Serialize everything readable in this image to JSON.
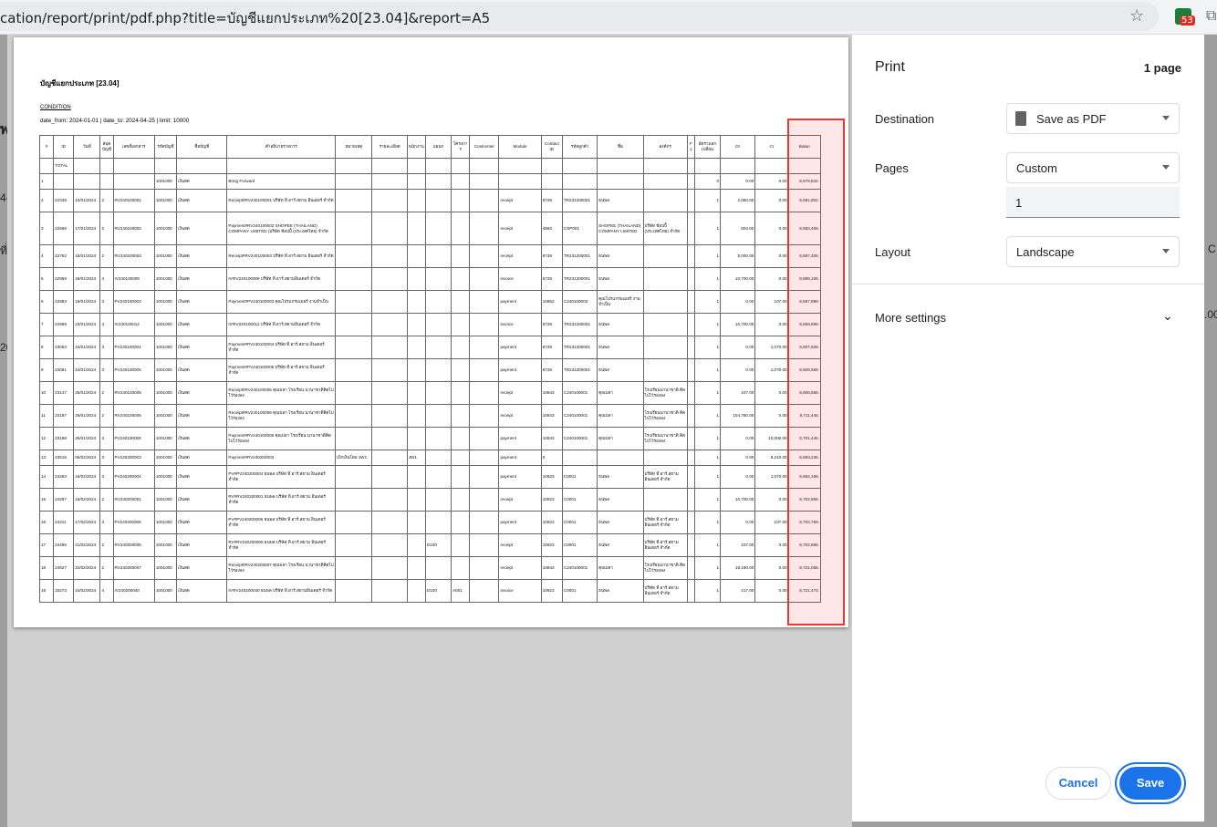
{
  "browser": {
    "url": "cation/report/print/pdf.php?title=บัญชีแยกประเภท%20[23.04]&report=A5",
    "extension_badge": "53"
  },
  "background_page": {
    "fragments": [
      {
        "text": "พ"
      },
      {
        "text": "4-"
      },
      {
        "text": "ที่"
      },
      {
        "text": "C"
      },
      {
        "text": "20"
      },
      {
        "text": ".00"
      }
    ]
  },
  "report": {
    "title": "บัญชีแยกประเภท [23.04]",
    "condition_label": "CONDITION",
    "condition_line": "date_from: 2024-01-01 | date_to: 2024-04-25 | limit: 10000",
    "headers": [
      "#",
      "ID",
      "วันที่",
      "สมุดบัญชี",
      "เลขที่เอกสาร",
      "รหัสบัญชี",
      "ชื่อบัญชี",
      "คำอธิบายรายการ",
      "หมายเหตุ",
      "รายละเอียด",
      "พนักงาน",
      "แผนก",
      "โครงการ",
      "Costcenter",
      "Module",
      "Contact ID",
      "รหัสลูกค้า",
      "ชื่อ",
      "องค์กร",
      "Fx",
      "อัตราแลกเปลี่ยน",
      "Dr",
      "Cr",
      "Balan"
    ],
    "total_label": "TOTAL",
    "rows": [
      [
        "1",
        "",
        "",
        "",
        "",
        "1001000",
        "เงินสด",
        "Bring Forward",
        "",
        "",
        "",
        "",
        "",
        "",
        "",
        "",
        "",
        "",
        "",
        "",
        "0",
        "0.00",
        "0.00",
        "8,579,842."
      ],
      [
        "2",
        "22338",
        "10/01/2024",
        "2",
        "RV240100001",
        "1001000",
        "เงินสด",
        "Receipt#RV240100001 บริษัท ที.อาร์.สยาม อินเตอร์ จำกัด",
        "",
        "",
        "",
        "",
        "",
        "",
        "receipt",
        "6729",
        "TR231200001",
        "ธนพล",
        "",
        "",
        "1",
        "2,060.00",
        "0.00",
        "8,581,902."
      ],
      [
        "3",
        "22669",
        "17/01/2024",
        "2",
        "RV240100002",
        "1001000",
        "เงินสด",
        "Payment#RV240100002 SHOPEE (THAILAND) COMPANY LIMITED (บริษัท ช้อปปี้ (ประเทศไทย) จำกัด",
        "",
        "",
        "",
        "",
        "",
        "",
        "receipt",
        "4963",
        "CSP001",
        "SHOPEE (THAILAND) COMPANY LIMITED",
        "บริษัท ช้อปปี้ (ประเทศไทย) จำกัด",
        "",
        "1",
        "504.00",
        "0.00",
        "8,582,406."
      ],
      [
        "4",
        "22762",
        "18/01/2024",
        "2",
        "RV240100003",
        "1001000",
        "เงินสด",
        "Receipt#RV240100003 บริษัท ที.อาร์.สยาม อินเตอร์ จำกัด",
        "",
        "",
        "",
        "",
        "",
        "",
        "receipt",
        "6729",
        "TR231200001",
        "ธนพล",
        "",
        "",
        "1",
        "5,000.00",
        "0.00",
        "8,587,406."
      ],
      [
        "5",
        "22959",
        "18/01/2024",
        "4",
        "IV240100009",
        "1001000",
        "เงินสด",
        "IV#IV240100009 บริษัท ที.อาร์.สยามอินเตอร์ จำกัด",
        "",
        "",
        "",
        "",
        "",
        "",
        "invoice",
        "6729",
        "TR231200001",
        "ธนพล",
        "",
        "",
        "1",
        "10,700.00",
        "0.00",
        "8,598,106."
      ],
      [
        "6",
        "22883",
        "19/01/2024",
        "3",
        "PV240100003",
        "1001000",
        "เงินสด",
        "Payment#PV240100003 คุณโปรแกรมเมอร์ งานจำเป็น",
        "",
        "",
        "",
        "",
        "",
        "",
        "payment",
        "10852",
        "C240100003",
        "คุณโปรแกรมเมอร์ งานจำเป็น",
        "",
        "",
        "1",
        "0.00",
        "107.00",
        "8,597,999."
      ],
      [
        "7",
        "22999",
        "23/01/2024",
        "4",
        "IV240100012",
        "1001000",
        "เงินสด",
        "IV#IV240100012 บริษัท ที.อาร์.สยามอินเตอร์ จำกัด",
        "",
        "",
        "",
        "",
        "",
        "",
        "invoice",
        "6729",
        "TR231200001",
        "ธนพล",
        "",
        "",
        "1",
        "10,700.00",
        "0.00",
        "8,608,699."
      ],
      [
        "8",
        "23053",
        "24/01/2024",
        "3",
        "PV240100004",
        "1001000",
        "เงินสด",
        "Payment#PV240100004 บริษัท ที.อาร์.สยาม อินเตอร์ จำกัด",
        "",
        "",
        "",
        "",
        "",
        "",
        "payment",
        "6729",
        "TR231200001",
        "ธนพล",
        "",
        "",
        "1",
        "0.00",
        "1,070.00",
        "8,607,629."
      ],
      [
        "9",
        "23061",
        "24/01/2024",
        "3",
        "PV240100005",
        "1001000",
        "เงินสด",
        "Payment#PV240100005 บริษัท ที.อาร์.สยาม อินเตอร์ จำกัด",
        "",
        "",
        "",
        "",
        "",
        "",
        "payment",
        "6729",
        "TR231200001",
        "ธนพล",
        "",
        "",
        "1",
        "0.00",
        "1,070.00",
        "8,606,559."
      ],
      [
        "10",
        "23147",
        "25/01/2024",
        "2",
        "RV240100005",
        "1001000",
        "เงินสด",
        "Receipt#RV240100005 คุณปลา โรงเรียน นานาชาติคิดไปไว้รองลง",
        "",
        "",
        "",
        "",
        "",
        "",
        "receipt",
        "10843",
        "C240100001",
        "คุณปลา",
        "โรงเรียนนานาชาติ คิดไปไว้รองลง",
        "",
        "1",
        "107.00",
        "0.00",
        "8,606,666."
      ],
      [
        "11",
        "23187",
        "26/01/2024",
        "2",
        "RV240100006",
        "1001000",
        "เงินสด",
        "Receipt#RV240100006 คุณปลา โรงเรียน นานาชาติคิดไปไว้รองลง",
        "",
        "",
        "",
        "",
        "",
        "",
        "receipt",
        "10843",
        "C240100001",
        "คุณปลา",
        "โรงเรียนนานาชาติ คิดไปไว้รองลง",
        "",
        "1",
        "104,780.00",
        "0.00",
        "8,711,446."
      ],
      [
        "12",
        "23188",
        "26/01/2024",
        "3",
        "PV240100006",
        "1001000",
        "เงินสด",
        "Payment#PV240100006 คุณปลา โรงเรียน นานาชาติคิดไปไว้รองลง",
        "",
        "",
        "",
        "",
        "",
        "",
        "payment",
        "10843",
        "C240100001",
        "คุณปลา",
        "โรงเรียนนานาชาติ คิดไปไว้รองลง",
        "",
        "1",
        "0.00",
        "10,000.00",
        "8,701,446."
      ],
      [
        "13",
        "23515",
        "05/02/2024",
        "3",
        "PV240200003",
        "1001000",
        "เงินสด",
        "Payment#PV240200003",
        "เบิกเงินโดย JW1",
        "",
        "JW1",
        "",
        "",
        "",
        "payment",
        "0",
        "",
        "",
        "",
        "",
        "1",
        "0.00",
        "8,210.00",
        "8,693,236."
      ],
      [
        "14",
        "24263",
        "16/02/2024",
        "3",
        "PV240200004",
        "1001000",
        "เงินสด",
        "PV#PV240200004 ธนพล บริษัท ที.อาร์.สยาม อินเตอร์ จำกัด",
        "",
        "",
        "",
        "",
        "",
        "",
        "payment",
        "10923",
        "C0001",
        "ธนพล",
        "บริษัท ที.อาร์.สยาม อินเตอร์ จำกัด",
        "",
        "1",
        "0.00",
        "1,070.00",
        "8,692,166."
      ],
      [
        "15",
        "24287",
        "16/02/2024",
        "2",
        "RV240200001",
        "1001000",
        "เงินสด",
        "RV#RV240200001 ธนพล บริษัท ที.อาร์.สยาม อินเตอร์ จำกัด",
        "",
        "",
        "",
        "",
        "",
        "",
        "receipt",
        "10923",
        "C0001",
        "ธนพล",
        "",
        "",
        "1",
        "10,700.00",
        "0.00",
        "8,702,866."
      ],
      [
        "16",
        "24311",
        "17/02/2024",
        "3",
        "PV240200006",
        "1001000",
        "เงินสด",
        "PV#PV240200006 ธนพล บริษัท ที.อาร์.สยาม อินเตอร์ จำกัด",
        "",
        "",
        "",
        "",
        "",
        "",
        "payment",
        "10923",
        "C0001",
        "ธนพล",
        "บริษัท ที.อาร์.สยาม อินเตอร์ จำกัด",
        "",
        "1",
        "0.00",
        "107.00",
        "8,702,759."
      ],
      [
        "17",
        "24495",
        "21/02/2024",
        "2",
        "RV240200005",
        "1001000",
        "เงินสด",
        "RV#RV240200005 ธนพล บริษัท ที.อาร์.สยาม อินเตอร์ จำกัด",
        "",
        "",
        "",
        "D100",
        "",
        "",
        "receipt",
        "10923",
        "C0001",
        "ธนพล",
        "บริษัท ที.อาร์.สยาม อินเตอร์ จำกัด",
        "",
        "1",
        "107.00",
        "0.00",
        "8,702,866."
      ],
      [
        "18",
        "24627",
        "22/02/2024",
        "2",
        "RV240200007",
        "1001000",
        "เงินสด",
        "Receipt#RV240200007 คุณปลา โรงเรียน นานาชาติคิดไปไว้รองลง",
        "",
        "",
        "",
        "",
        "",
        "",
        "receipt",
        "10843",
        "C240100001",
        "คุณปลา",
        "โรงเรียนนานาชาติ คิดไปไว้รองลง",
        "",
        "1",
        "18,190.00",
        "0.00",
        "8,721,056."
      ],
      [
        "19",
        "33273",
        "24/02/2024",
        "4",
        "IV240200040",
        "1001000",
        "เงินสด",
        "IV#IV240200040 ธนพล บริษัท ที.อาร์.สยามอินเตอร์ จำกัด",
        "",
        "",
        "",
        "D100",
        "A001",
        "",
        "invoice",
        "10923",
        "C0001",
        "ธนพล",
        "บริษัท ที.อาร์.สยาม อินเตอร์ จำกัด",
        "",
        "1",
        "417.00",
        "0.00",
        "8,721,473."
      ]
    ]
  },
  "print_dialog": {
    "title": "Print",
    "page_count": "1 page",
    "destination_label": "Destination",
    "destination_value": "Save as PDF",
    "pages_label": "Pages",
    "pages_value": "Custom",
    "pages_custom_value": "1",
    "layout_label": "Layout",
    "layout_value": "Landscape",
    "more_settings_label": "More settings",
    "cancel_label": "Cancel",
    "save_label": "Save"
  },
  "colors": {
    "accent": "#1a73e8",
    "highlight": "#e53935"
  }
}
